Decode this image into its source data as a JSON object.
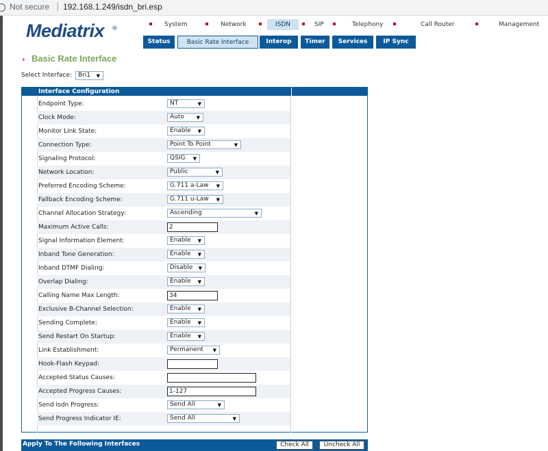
{
  "browser": {
    "security": "Not secure",
    "url": "192.168.1.249/isdn_bri.esp"
  },
  "logo": {
    "text": "Mediatrix",
    "mark": "®"
  },
  "nav_primary": [
    {
      "label": "System"
    },
    {
      "label": "Network"
    },
    {
      "label": "ISDN",
      "active": true
    },
    {
      "label": "SIP"
    },
    {
      "label": "Telephony"
    },
    {
      "label": "Call Router"
    },
    {
      "label": "Management"
    }
  ],
  "nav_secondary": [
    {
      "label": "Status"
    },
    {
      "label": "Basic Rate Interface",
      "active": true
    },
    {
      "label": "Interop"
    },
    {
      "label": "Timer"
    },
    {
      "label": "Services"
    },
    {
      "label": "IP Sync"
    }
  ],
  "page": {
    "title": "Basic Rate Interface"
  },
  "interface_select": {
    "label": "Select Interface:",
    "value": "Bri1"
  },
  "config": {
    "header": "Interface Configuration",
    "rows": [
      {
        "label": "Endpoint Type:",
        "type": "select",
        "value": "NT"
      },
      {
        "label": "Clock Mode:",
        "type": "select",
        "value": "Auto"
      },
      {
        "label": "Monitor Link State:",
        "type": "select",
        "value": "Enable"
      },
      {
        "label": "Connection Type:",
        "type": "select",
        "value": "Point To Point"
      },
      {
        "label": "Signaling Protocol:",
        "type": "select",
        "value": "QSIG"
      },
      {
        "label": "Network Location:",
        "type": "select",
        "value": "Public"
      },
      {
        "label": "Preferred Encoding Scheme:",
        "type": "select",
        "value": "G.711 a-Law"
      },
      {
        "label": "Fallback Encoding Scheme:",
        "type": "select",
        "value": "G.711 u-Law"
      },
      {
        "label": "Channel Allocation Strategy:",
        "type": "select",
        "value": "Ascending"
      },
      {
        "label": "Maximum Active Calls:",
        "type": "input",
        "value": "2"
      },
      {
        "label": "Signal Information Element:",
        "type": "select",
        "value": "Enable"
      },
      {
        "label": "Inband Tone Generation:",
        "type": "select",
        "value": "Enable"
      },
      {
        "label": "Inband DTMF Dialing:",
        "type": "select",
        "value": "Disable"
      },
      {
        "label": "Overlap Dialing:",
        "type": "select",
        "value": "Enable"
      },
      {
        "label": "Calling Name Max Length:",
        "type": "input",
        "value": "34"
      },
      {
        "label": "Exclusive B-Channel Selection:",
        "type": "select",
        "value": "Enable"
      },
      {
        "label": "Sending Complete:",
        "type": "select",
        "value": "Enable"
      },
      {
        "label": "Send Restart On Startup:",
        "type": "select",
        "value": "Enable"
      },
      {
        "label": "Link Establishment:",
        "type": "select",
        "value": "Permanent"
      },
      {
        "label": "Hook-Flash Keypad:",
        "type": "input",
        "value": ""
      },
      {
        "label": "Accepted Status Causes:",
        "type": "input",
        "value": ""
      },
      {
        "label": "Accepted Progress Causes:",
        "type": "input",
        "value": "1-127"
      },
      {
        "label": "Send Isdn Progress:",
        "type": "select",
        "value": "Send All"
      },
      {
        "label": "Send Progress Indicator IE:",
        "type": "select",
        "value": "Send All"
      }
    ]
  },
  "apply": {
    "title": "Apply To The Following Interfaces",
    "check_all": "Check All",
    "uncheck_all": "Uncheck All"
  },
  "colors": {
    "primary_blue": "#0d5a9a",
    "title_green": "#7fa35a",
    "bullet_red": "#c0001a",
    "logo_blue": "#1e4b86"
  }
}
